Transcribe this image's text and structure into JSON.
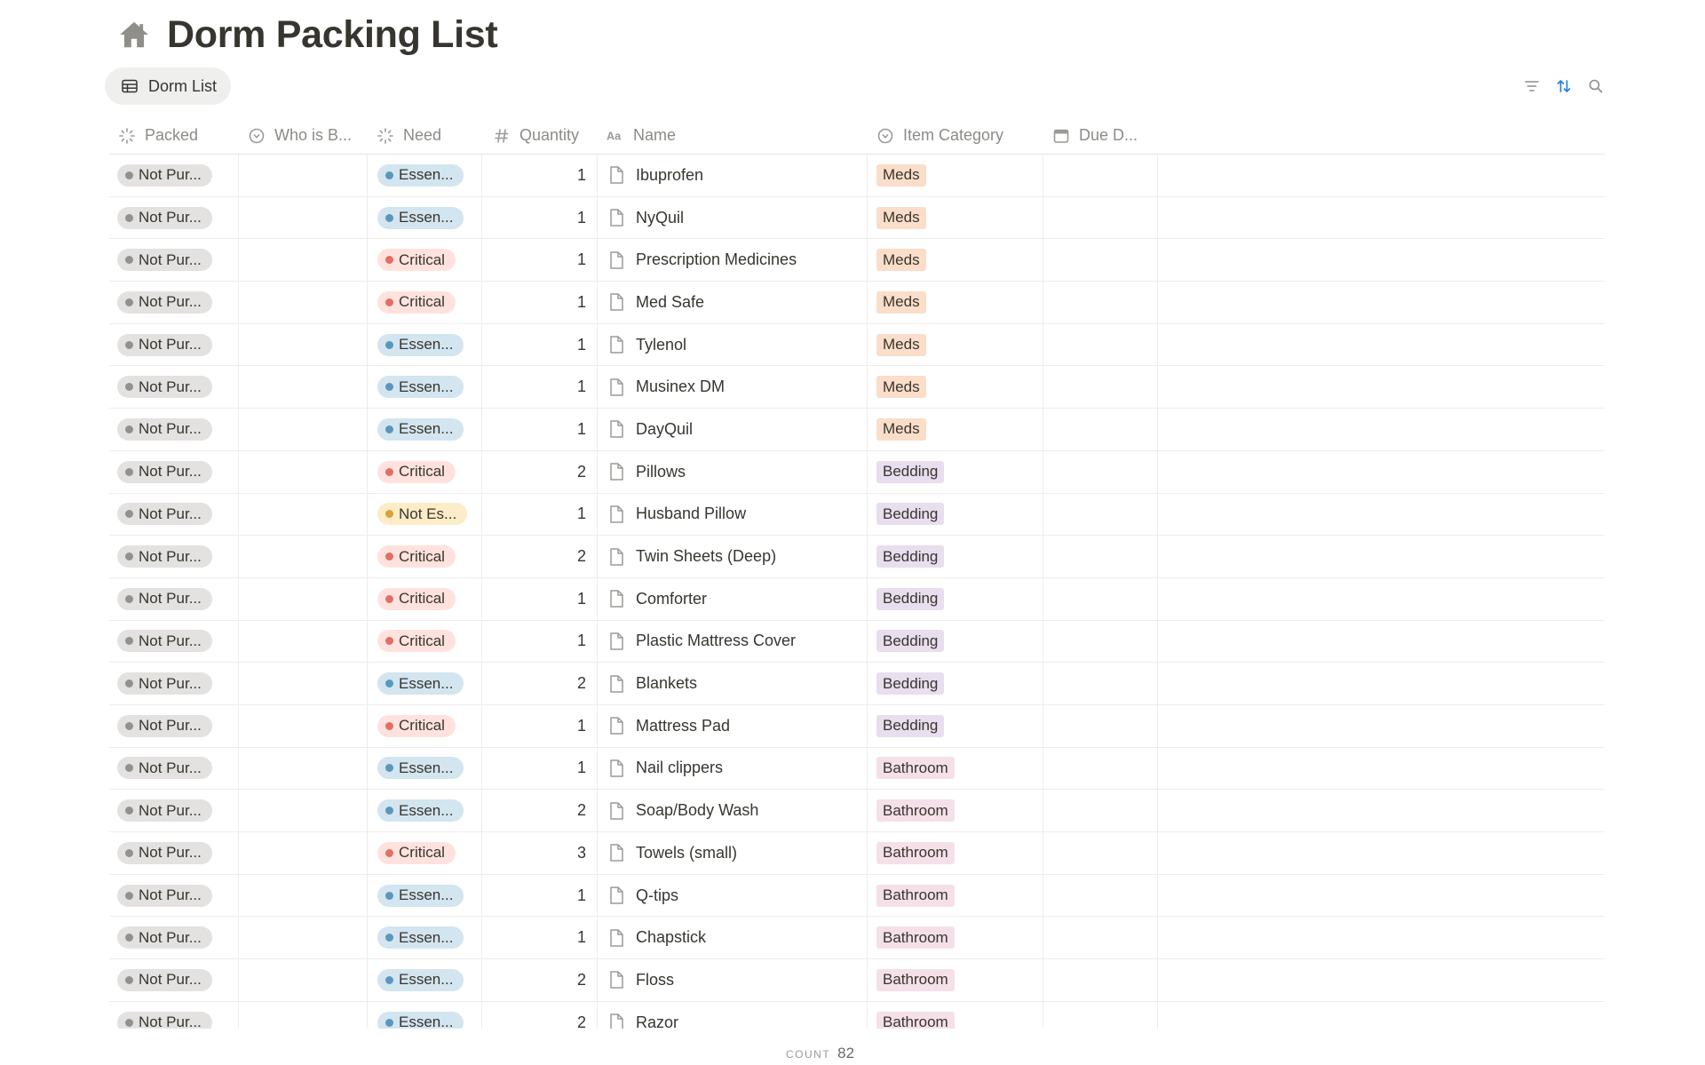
{
  "page": {
    "title": "Dorm Packing List",
    "icon": "home-icon"
  },
  "view": {
    "tab_label": "Dorm List",
    "tab_icon": "table-icon"
  },
  "toolbar": {
    "icons": [
      "filter-icon",
      "sort-icon",
      "search-icon"
    ],
    "accent_color": "#2383e2"
  },
  "columns": {
    "packed": "Packed",
    "who": "Who is B...",
    "need": "Need",
    "quantity": "Quantity",
    "name": "Name",
    "category": "Item Category",
    "due": "Due D..."
  },
  "rows": [
    {
      "packed": "Not Pur...",
      "who": "",
      "need": "Essen...",
      "need_level": "blue",
      "quantity": "1",
      "name": "Ibuprofen",
      "category": "Meds",
      "category_style": "meds",
      "due": ""
    },
    {
      "packed": "Not Pur...",
      "who": "",
      "need": "Essen...",
      "need_level": "blue",
      "quantity": "1",
      "name": "NyQuil",
      "category": "Meds",
      "category_style": "meds",
      "due": ""
    },
    {
      "packed": "Not Pur...",
      "who": "",
      "need": "Critical",
      "need_level": "red",
      "quantity": "1",
      "name": "Prescription Medicines",
      "category": "Meds",
      "category_style": "meds",
      "due": ""
    },
    {
      "packed": "Not Pur...",
      "who": "",
      "need": "Critical",
      "need_level": "red",
      "quantity": "1",
      "name": "Med Safe",
      "category": "Meds",
      "category_style": "meds",
      "due": ""
    },
    {
      "packed": "Not Pur...",
      "who": "",
      "need": "Essen...",
      "need_level": "blue",
      "quantity": "1",
      "name": "Tylenol",
      "category": "Meds",
      "category_style": "meds",
      "due": ""
    },
    {
      "packed": "Not Pur...",
      "who": "",
      "need": "Essen...",
      "need_level": "blue",
      "quantity": "1",
      "name": "Musinex DM",
      "category": "Meds",
      "category_style": "meds",
      "due": ""
    },
    {
      "packed": "Not Pur...",
      "who": "",
      "need": "Essen...",
      "need_level": "blue",
      "quantity": "1",
      "name": "DayQuil",
      "category": "Meds",
      "category_style": "meds",
      "due": ""
    },
    {
      "packed": "Not Pur...",
      "who": "",
      "need": "Critical",
      "need_level": "red",
      "quantity": "2",
      "name": "Pillows",
      "category": "Bedding",
      "category_style": "bedding",
      "due": ""
    },
    {
      "packed": "Not Pur...",
      "who": "",
      "need": "Not Es...",
      "need_level": "yellow",
      "quantity": "1",
      "name": "Husband Pillow",
      "category": "Bedding",
      "category_style": "bedding",
      "due": ""
    },
    {
      "packed": "Not Pur...",
      "who": "",
      "need": "Critical",
      "need_level": "red",
      "quantity": "2",
      "name": "Twin Sheets (Deep)",
      "category": "Bedding",
      "category_style": "bedding",
      "due": ""
    },
    {
      "packed": "Not Pur...",
      "who": "",
      "need": "Critical",
      "need_level": "red",
      "quantity": "1",
      "name": "Comforter",
      "category": "Bedding",
      "category_style": "bedding",
      "due": ""
    },
    {
      "packed": "Not Pur...",
      "who": "",
      "need": "Critical",
      "need_level": "red",
      "quantity": "1",
      "name": "Plastic Mattress Cover",
      "category": "Bedding",
      "category_style": "bedding",
      "due": ""
    },
    {
      "packed": "Not Pur...",
      "who": "",
      "need": "Essen...",
      "need_level": "blue",
      "quantity": "2",
      "name": "Blankets",
      "category": "Bedding",
      "category_style": "bedding",
      "due": ""
    },
    {
      "packed": "Not Pur...",
      "who": "",
      "need": "Critical",
      "need_level": "red",
      "quantity": "1",
      "name": "Mattress Pad",
      "category": "Bedding",
      "category_style": "bedding",
      "due": ""
    },
    {
      "packed": "Not Pur...",
      "who": "",
      "need": "Essen...",
      "need_level": "blue",
      "quantity": "1",
      "name": "Nail clippers",
      "category": "Bathroom",
      "category_style": "bathroom",
      "due": ""
    },
    {
      "packed": "Not Pur...",
      "who": "",
      "need": "Essen...",
      "need_level": "blue",
      "quantity": "2",
      "name": "Soap/Body Wash",
      "category": "Bathroom",
      "category_style": "bathroom",
      "due": ""
    },
    {
      "packed": "Not Pur...",
      "who": "",
      "need": "Critical",
      "need_level": "red",
      "quantity": "3",
      "name": "Towels (small)",
      "category": "Bathroom",
      "category_style": "bathroom",
      "due": ""
    },
    {
      "packed": "Not Pur...",
      "who": "",
      "need": "Essen...",
      "need_level": "blue",
      "quantity": "1",
      "name": "Q-tips",
      "category": "Bathroom",
      "category_style": "bathroom",
      "due": ""
    },
    {
      "packed": "Not Pur...",
      "who": "",
      "need": "Essen...",
      "need_level": "blue",
      "quantity": "1",
      "name": "Chapstick",
      "category": "Bathroom",
      "category_style": "bathroom",
      "due": ""
    },
    {
      "packed": "Not Pur...",
      "who": "",
      "need": "Essen...",
      "need_level": "blue",
      "quantity": "2",
      "name": "Floss",
      "category": "Bathroom",
      "category_style": "bathroom",
      "due": ""
    },
    {
      "packed": "Not Pur...",
      "who": "",
      "need": "Essen...",
      "need_level": "blue",
      "quantity": "2",
      "name": "Razor",
      "category": "Bathroom",
      "category_style": "bathroom",
      "due": ""
    }
  ],
  "footer": {
    "count_label": "COUNT",
    "count_value": "82"
  }
}
